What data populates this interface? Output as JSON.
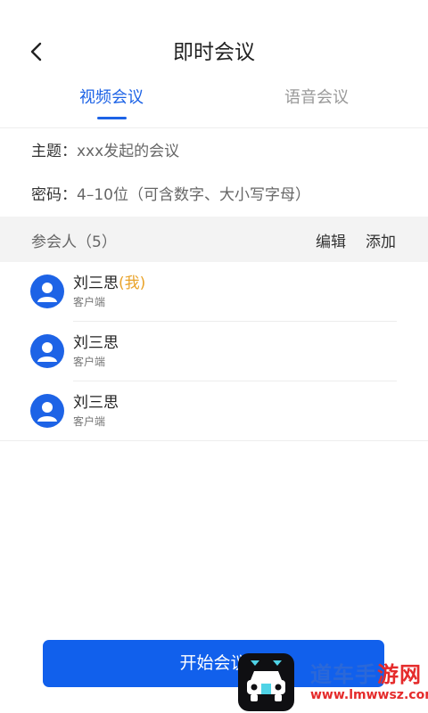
{
  "header": {
    "title": "即时会议",
    "back_icon": "chevron-left-icon"
  },
  "tabs": [
    {
      "label": "视频会议",
      "active": true
    },
    {
      "label": "语音会议",
      "active": false
    }
  ],
  "form": {
    "topic": {
      "label": "主题：",
      "value": "xxx发起的会议"
    },
    "password": {
      "label": "密码：",
      "value": "4–10位（可含数字、大小写字母）"
    }
  },
  "participants": {
    "title": "参会人（5）",
    "edit_label": "编辑",
    "add_label": "添加",
    "items": [
      {
        "name": "刘三思",
        "tag": "(我)",
        "device": "客户端"
      },
      {
        "name": "刘三思",
        "tag": "",
        "device": "客户端"
      },
      {
        "name": "刘三思",
        "tag": "",
        "device": "客户端"
      }
    ]
  },
  "footer": {
    "start_label": "开始会议"
  },
  "watermark": {
    "brand_a": "道车手",
    "brand_b": "游网",
    "url": "www.lmwwsz.com"
  },
  "colors": {
    "accent": "#1d63e6",
    "button": "#1160ec",
    "me_tag": "#e9a32a",
    "bar_bg": "#f3f3f3"
  }
}
